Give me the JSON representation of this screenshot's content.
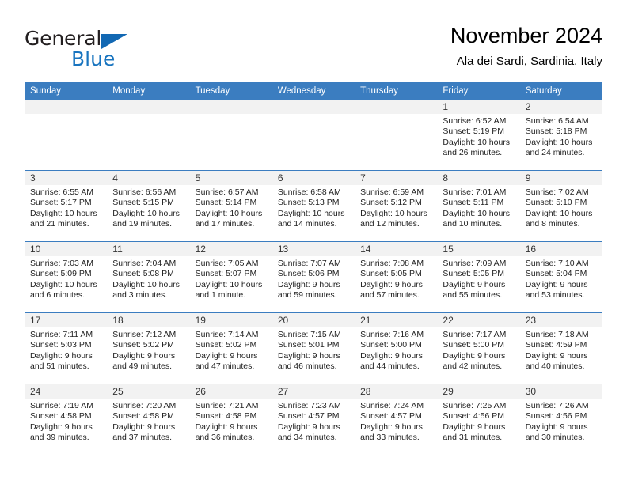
{
  "brand": {
    "word_one": "General",
    "word_two": "Blue",
    "accent_color": "#1874bf",
    "triangle_icon": "triangle-icon"
  },
  "header": {
    "title": "November 2024",
    "subtitle": "Ala dei Sardi, Sardinia, Italy"
  },
  "calendar": {
    "header_bg": "#3b7dc0",
    "daynum_bg": "#f2f2f2",
    "weekdays": [
      "Sunday",
      "Monday",
      "Tuesday",
      "Wednesday",
      "Thursday",
      "Friday",
      "Saturday"
    ],
    "weeks": [
      [
        {
          "day": "",
          "sunrise": "",
          "sunset": "",
          "daylight": ""
        },
        {
          "day": "",
          "sunrise": "",
          "sunset": "",
          "daylight": ""
        },
        {
          "day": "",
          "sunrise": "",
          "sunset": "",
          "daylight": ""
        },
        {
          "day": "",
          "sunrise": "",
          "sunset": "",
          "daylight": ""
        },
        {
          "day": "",
          "sunrise": "",
          "sunset": "",
          "daylight": ""
        },
        {
          "day": "1",
          "sunrise": "Sunrise: 6:52 AM",
          "sunset": "Sunset: 5:19 PM",
          "daylight": "Daylight: 10 hours and 26 minutes."
        },
        {
          "day": "2",
          "sunrise": "Sunrise: 6:54 AM",
          "sunset": "Sunset: 5:18 PM",
          "daylight": "Daylight: 10 hours and 24 minutes."
        }
      ],
      [
        {
          "day": "3",
          "sunrise": "Sunrise: 6:55 AM",
          "sunset": "Sunset: 5:17 PM",
          "daylight": "Daylight: 10 hours and 21 minutes."
        },
        {
          "day": "4",
          "sunrise": "Sunrise: 6:56 AM",
          "sunset": "Sunset: 5:15 PM",
          "daylight": "Daylight: 10 hours and 19 minutes."
        },
        {
          "day": "5",
          "sunrise": "Sunrise: 6:57 AM",
          "sunset": "Sunset: 5:14 PM",
          "daylight": "Daylight: 10 hours and 17 minutes."
        },
        {
          "day": "6",
          "sunrise": "Sunrise: 6:58 AM",
          "sunset": "Sunset: 5:13 PM",
          "daylight": "Daylight: 10 hours and 14 minutes."
        },
        {
          "day": "7",
          "sunrise": "Sunrise: 6:59 AM",
          "sunset": "Sunset: 5:12 PM",
          "daylight": "Daylight: 10 hours and 12 minutes."
        },
        {
          "day": "8",
          "sunrise": "Sunrise: 7:01 AM",
          "sunset": "Sunset: 5:11 PM",
          "daylight": "Daylight: 10 hours and 10 minutes."
        },
        {
          "day": "9",
          "sunrise": "Sunrise: 7:02 AM",
          "sunset": "Sunset: 5:10 PM",
          "daylight": "Daylight: 10 hours and 8 minutes."
        }
      ],
      [
        {
          "day": "10",
          "sunrise": "Sunrise: 7:03 AM",
          "sunset": "Sunset: 5:09 PM",
          "daylight": "Daylight: 10 hours and 6 minutes."
        },
        {
          "day": "11",
          "sunrise": "Sunrise: 7:04 AM",
          "sunset": "Sunset: 5:08 PM",
          "daylight": "Daylight: 10 hours and 3 minutes."
        },
        {
          "day": "12",
          "sunrise": "Sunrise: 7:05 AM",
          "sunset": "Sunset: 5:07 PM",
          "daylight": "Daylight: 10 hours and 1 minute."
        },
        {
          "day": "13",
          "sunrise": "Sunrise: 7:07 AM",
          "sunset": "Sunset: 5:06 PM",
          "daylight": "Daylight: 9 hours and 59 minutes."
        },
        {
          "day": "14",
          "sunrise": "Sunrise: 7:08 AM",
          "sunset": "Sunset: 5:05 PM",
          "daylight": "Daylight: 9 hours and 57 minutes."
        },
        {
          "day": "15",
          "sunrise": "Sunrise: 7:09 AM",
          "sunset": "Sunset: 5:05 PM",
          "daylight": "Daylight: 9 hours and 55 minutes."
        },
        {
          "day": "16",
          "sunrise": "Sunrise: 7:10 AM",
          "sunset": "Sunset: 5:04 PM",
          "daylight": "Daylight: 9 hours and 53 minutes."
        }
      ],
      [
        {
          "day": "17",
          "sunrise": "Sunrise: 7:11 AM",
          "sunset": "Sunset: 5:03 PM",
          "daylight": "Daylight: 9 hours and 51 minutes."
        },
        {
          "day": "18",
          "sunrise": "Sunrise: 7:12 AM",
          "sunset": "Sunset: 5:02 PM",
          "daylight": "Daylight: 9 hours and 49 minutes."
        },
        {
          "day": "19",
          "sunrise": "Sunrise: 7:14 AM",
          "sunset": "Sunset: 5:02 PM",
          "daylight": "Daylight: 9 hours and 47 minutes."
        },
        {
          "day": "20",
          "sunrise": "Sunrise: 7:15 AM",
          "sunset": "Sunset: 5:01 PM",
          "daylight": "Daylight: 9 hours and 46 minutes."
        },
        {
          "day": "21",
          "sunrise": "Sunrise: 7:16 AM",
          "sunset": "Sunset: 5:00 PM",
          "daylight": "Daylight: 9 hours and 44 minutes."
        },
        {
          "day": "22",
          "sunrise": "Sunrise: 7:17 AM",
          "sunset": "Sunset: 5:00 PM",
          "daylight": "Daylight: 9 hours and 42 minutes."
        },
        {
          "day": "23",
          "sunrise": "Sunrise: 7:18 AM",
          "sunset": "Sunset: 4:59 PM",
          "daylight": "Daylight: 9 hours and 40 minutes."
        }
      ],
      [
        {
          "day": "24",
          "sunrise": "Sunrise: 7:19 AM",
          "sunset": "Sunset: 4:58 PM",
          "daylight": "Daylight: 9 hours and 39 minutes."
        },
        {
          "day": "25",
          "sunrise": "Sunrise: 7:20 AM",
          "sunset": "Sunset: 4:58 PM",
          "daylight": "Daylight: 9 hours and 37 minutes."
        },
        {
          "day": "26",
          "sunrise": "Sunrise: 7:21 AM",
          "sunset": "Sunset: 4:58 PM",
          "daylight": "Daylight: 9 hours and 36 minutes."
        },
        {
          "day": "27",
          "sunrise": "Sunrise: 7:23 AM",
          "sunset": "Sunset: 4:57 PM",
          "daylight": "Daylight: 9 hours and 34 minutes."
        },
        {
          "day": "28",
          "sunrise": "Sunrise: 7:24 AM",
          "sunset": "Sunset: 4:57 PM",
          "daylight": "Daylight: 9 hours and 33 minutes."
        },
        {
          "day": "29",
          "sunrise": "Sunrise: 7:25 AM",
          "sunset": "Sunset: 4:56 PM",
          "daylight": "Daylight: 9 hours and 31 minutes."
        },
        {
          "day": "30",
          "sunrise": "Sunrise: 7:26 AM",
          "sunset": "Sunset: 4:56 PM",
          "daylight": "Daylight: 9 hours and 30 minutes."
        }
      ]
    ]
  }
}
